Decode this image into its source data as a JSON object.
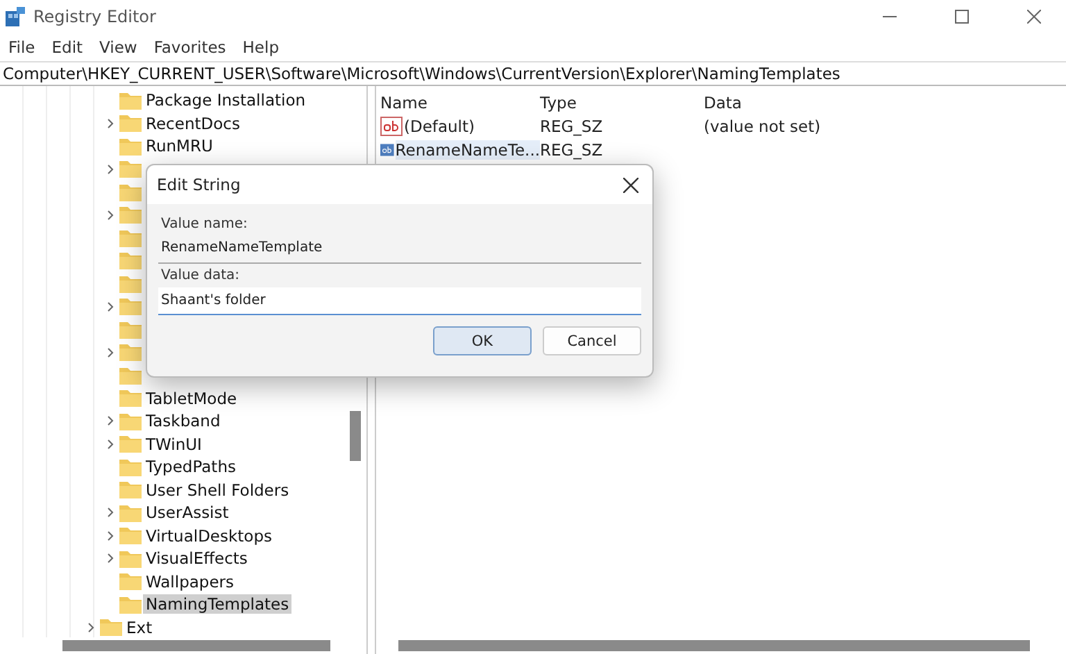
{
  "window": {
    "title": "Registry Editor"
  },
  "menu": [
    "File",
    "Edit",
    "View",
    "Favorites",
    "Help"
  ],
  "address": "Computer\\HKEY_CURRENT_USER\\Software\\Microsoft\\Windows\\CurrentVersion\\Explorer\\NamingTemplates",
  "tree": [
    {
      "children": [
        {
          "label": "Package Installation",
          "expandable": false,
          "selected": false
        },
        {
          "label": "RecentDocs",
          "expandable": true,
          "selected": false
        },
        {
          "label": "RunMRU",
          "expandable": false,
          "selected": false
        },
        {
          "expandable": true
        },
        {
          "expandable": false
        },
        {
          "expandable": true
        },
        {
          "expandable": false
        },
        {
          "expandable": false
        },
        {
          "expandable": false
        },
        {
          "expandable": true
        },
        {
          "expandable": false
        },
        {
          "expandable": true
        },
        {
          "expandable": false
        },
        {
          "label": "TabletMode",
          "expandable": false,
          "selected": false
        },
        {
          "label": "Taskband",
          "expandable": true,
          "selected": false
        },
        {
          "label": "TWinUI",
          "expandable": true,
          "selected": false
        },
        {
          "label": "TypedPaths",
          "expandable": false,
          "selected": false
        },
        {
          "label": "User Shell Folders",
          "expandable": false,
          "selected": false
        },
        {
          "label": "UserAssist",
          "expandable": true,
          "selected": false
        },
        {
          "label": "VirtualDesktops",
          "expandable": true,
          "selected": false
        },
        {
          "label": "VisualEffects",
          "expandable": true,
          "selected": false
        },
        {
          "label": "Wallpapers",
          "expandable": false,
          "selected": false
        },
        {
          "label": "NamingTemplates",
          "expandable": false,
          "selected": true
        }
      ]
    },
    {
      "label": "Ext",
      "expandable": true,
      "selected": false
    }
  ],
  "table": {
    "columns": [
      "Name",
      "Type",
      "Data"
    ],
    "rows": [
      {
        "name": "(Default)",
        "type": "REG_SZ",
        "data": "(value not set)",
        "selected": false
      },
      {
        "name": "RenameNameTe...",
        "type": "REG_SZ",
        "selected": true
      }
    ]
  },
  "dialog": {
    "title": "Edit String",
    "value_name_label": "Value name:",
    "value_name": "RenameNameTemplate",
    "value_data_label": "Value data:",
    "value_data": "Shaant's folder",
    "buttons": [
      {
        "label": "OK",
        "default": true
      },
      {
        "label": "Cancel",
        "default": false
      }
    ]
  }
}
